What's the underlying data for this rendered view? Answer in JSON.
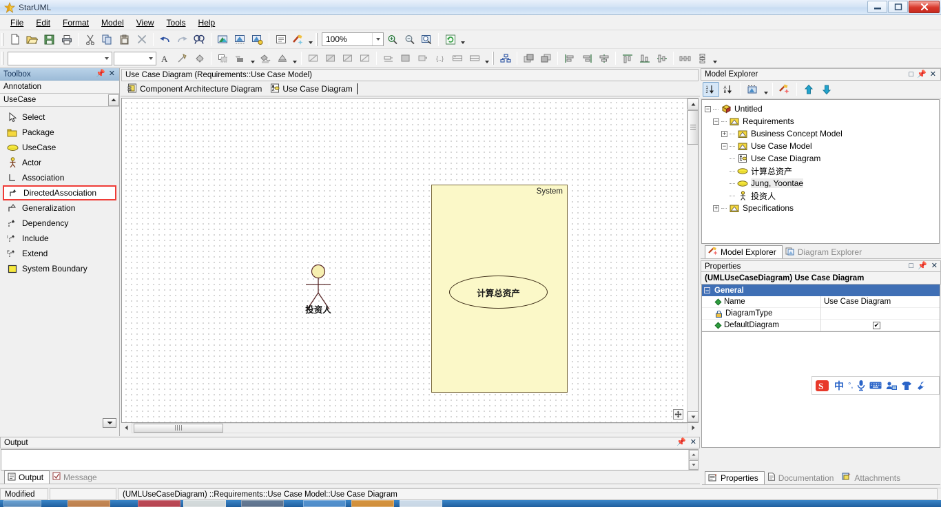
{
  "window": {
    "title": "StarUML",
    "minimize_label": "—",
    "maximize_label": "❐",
    "close_label": "✕"
  },
  "menubar": {
    "items": [
      {
        "label": "File"
      },
      {
        "label": "Edit"
      },
      {
        "label": "Format"
      },
      {
        "label": "Model"
      },
      {
        "label": "View"
      },
      {
        "label": "Tools"
      },
      {
        "label": "Help"
      }
    ]
  },
  "toolbar_main": {
    "zoom_value": "100%",
    "buttons": [
      {
        "name": "new-file-icon",
        "title": "New"
      },
      {
        "name": "open-file-icon",
        "title": "Open"
      },
      {
        "name": "save-icon",
        "title": "Save"
      },
      {
        "name": "print-icon",
        "title": "Print"
      },
      {
        "name": "cut-icon",
        "title": "Cut"
      },
      {
        "name": "copy-icon",
        "title": "Copy"
      },
      {
        "name": "paste-icon",
        "title": "Paste"
      },
      {
        "name": "delete-icon",
        "title": "Delete"
      },
      {
        "name": "undo-icon",
        "title": "Undo"
      },
      {
        "name": "redo-icon",
        "title": "Redo"
      },
      {
        "name": "find-icon",
        "title": "Find"
      },
      {
        "name": "add-diagram-icon",
        "title": "Add Diagram"
      },
      {
        "name": "add-model-icon",
        "title": "Add Model"
      },
      {
        "name": "profile-icon",
        "title": "Profile"
      },
      {
        "name": "documentation-icon",
        "title": "Documentation"
      },
      {
        "name": "verify-icon",
        "title": "Verify Model"
      },
      {
        "name": "zoom-in-icon",
        "title": "Zoom In"
      },
      {
        "name": "zoom-out-icon",
        "title": "Zoom Out"
      },
      {
        "name": "fit-window-icon",
        "title": "Fit to Window"
      },
      {
        "name": "refresh-icon",
        "title": "Refresh"
      }
    ]
  },
  "toolbar_format": {
    "font_name": "",
    "font_size": "",
    "buttons": [
      {
        "name": "font-color-icon"
      },
      {
        "name": "line-style-icon"
      },
      {
        "name": "fill-color-icon"
      },
      {
        "name": "shadow-icon"
      },
      {
        "name": "stereotype-display-icon"
      },
      {
        "name": "line-color-icon"
      },
      {
        "name": "fill-style-icon"
      },
      {
        "name": "suppress-attributes-icon"
      },
      {
        "name": "suppress-operations-icon"
      },
      {
        "name": "word-wrap-icon"
      },
      {
        "name": "show-visibility-icon"
      },
      {
        "name": "show-namespace-icon"
      },
      {
        "name": "show-property-icon"
      },
      {
        "name": "show-type-icon"
      },
      {
        "name": "show-multiplicity-icon"
      },
      {
        "name": "auto-resize-icon"
      },
      {
        "name": "layout-diagram-icon"
      },
      {
        "name": "bring-to-front-icon"
      },
      {
        "name": "send-to-back-icon"
      },
      {
        "name": "align-left-icon"
      },
      {
        "name": "align-right-icon"
      },
      {
        "name": "align-center-icon"
      },
      {
        "name": "align-top-icon"
      },
      {
        "name": "align-bottom-icon"
      },
      {
        "name": "align-middle-icon"
      },
      {
        "name": "space-horizontally-icon"
      },
      {
        "name": "space-vertically-icon"
      }
    ]
  },
  "toolbox": {
    "caption": "Toolbox",
    "annotation_group": "Annotation",
    "usecase_group": "UseCase",
    "items": [
      {
        "label": "Select",
        "icon": "cursor-arrow-icon"
      },
      {
        "label": "Package",
        "icon": "package-folder-icon"
      },
      {
        "label": "UseCase",
        "icon": "usecase-ellipse-icon"
      },
      {
        "label": "Actor",
        "icon": "actor-stickman-icon"
      },
      {
        "label": "Association",
        "icon": "association-line-icon"
      },
      {
        "label": "DirectedAssociation",
        "icon": "directed-association-icon",
        "selected": true
      },
      {
        "label": "Generalization",
        "icon": "generalization-icon"
      },
      {
        "label": "Dependency",
        "icon": "dependency-icon"
      },
      {
        "label": "Include",
        "icon": "include-icon"
      },
      {
        "label": "Extend",
        "icon": "extend-icon"
      },
      {
        "label": "System Boundary",
        "icon": "system-boundary-icon"
      }
    ]
  },
  "editor": {
    "title": "Use Case Diagram (Requirements::Use Case Model)",
    "tabs": [
      {
        "label": "Component Architecture Diagram",
        "icon": "component-diagram-icon",
        "active": false
      },
      {
        "label": "Use Case Diagram",
        "icon": "usecase-diagram-icon",
        "active": true
      }
    ]
  },
  "diagram": {
    "system_boundary_label": "System",
    "usecase_label": "计算总资产",
    "actor_label": "投资人",
    "system_fill": "#fbf8c8",
    "system_border": "#7a6a3a"
  },
  "model_explorer": {
    "caption": "Model Explorer",
    "toolbar": [
      {
        "name": "sort-by-order-icon"
      },
      {
        "name": "sort-alphabetically-icon"
      },
      {
        "name": "filter-view-icon"
      },
      {
        "name": "select-in-diagram-icon"
      },
      {
        "name": "move-up-icon"
      },
      {
        "name": "move-down-icon"
      }
    ],
    "tree": [
      {
        "label": "Untitled",
        "depth": 0,
        "expander": "-",
        "icon": "project-cube-icon"
      },
      {
        "label": "Requirements",
        "depth": 1,
        "expander": "-",
        "icon": "model-package-icon"
      },
      {
        "label": "Business Concept Model",
        "depth": 2,
        "expander": "+",
        "icon": "model-package-icon"
      },
      {
        "label": "Use Case Model",
        "depth": 2,
        "expander": "-",
        "icon": "model-package-icon"
      },
      {
        "label": "Use Case Diagram",
        "depth": 3,
        "expander": "",
        "icon": "usecase-diagram-icon"
      },
      {
        "label": "计算总资产",
        "depth": 3,
        "expander": "",
        "icon": "usecase-ellipse-icon"
      },
      {
        "label": "Jung, Yoontae",
        "depth": 3,
        "expander": "",
        "icon": "usecase-ellipse-icon",
        "selected": true
      },
      {
        "label": "投资人",
        "depth": 3,
        "expander": "",
        "icon": "actor-stickman-icon"
      },
      {
        "label": "Specifications",
        "depth": 1,
        "expander": "+",
        "icon": "model-package-icon"
      }
    ],
    "tabs": [
      {
        "label": "Model Explorer",
        "icon": "model-explorer-icon",
        "active": true
      },
      {
        "label": "Diagram Explorer",
        "icon": "diagram-explorer-icon",
        "active": false
      }
    ]
  },
  "properties": {
    "caption": "Properties",
    "header": "(UMLUseCaseDiagram) Use Case Diagram",
    "group_label": "General",
    "rows": [
      {
        "name": "Name",
        "value": "Use Case Diagram",
        "marker": "diamond",
        "type": "text"
      },
      {
        "name": "DiagramType",
        "value": "",
        "marker": "lock",
        "type": "text"
      },
      {
        "name": "DefaultDiagram",
        "value": "✔",
        "marker": "diamond",
        "type": "checkbox"
      }
    ],
    "tabs": [
      {
        "label": "Properties",
        "icon": "properties-icon",
        "active": true
      },
      {
        "label": "Documentation",
        "icon": "documentation-page-icon",
        "active": false
      },
      {
        "label": "Attachments",
        "icon": "attachments-icon",
        "active": false
      }
    ]
  },
  "output": {
    "caption": "Output",
    "content": "",
    "tabs": [
      {
        "label": "Output",
        "icon": "output-icon",
        "active": true
      },
      {
        "label": "Message",
        "icon": "message-check-icon",
        "active": false
      }
    ]
  },
  "ime": {
    "logo": "sogou-logo-icon",
    "items": [
      {
        "name": "chinese-mode-icon",
        "label": "中"
      },
      {
        "name": "punctuation-icon",
        "label": "°,"
      },
      {
        "name": "microphone-icon",
        "label": ""
      },
      {
        "name": "soft-keyboard-icon",
        "label": ""
      },
      {
        "name": "user-panel-icon",
        "label": ""
      },
      {
        "name": "skin-icon",
        "label": ""
      },
      {
        "name": "toolbox-wrench-icon",
        "label": ""
      }
    ]
  },
  "statusbar": {
    "state": "Modified",
    "middle": "",
    "path": "(UMLUseCaseDiagram) ::Requirements::Use Case Model::Use Case Diagram"
  }
}
